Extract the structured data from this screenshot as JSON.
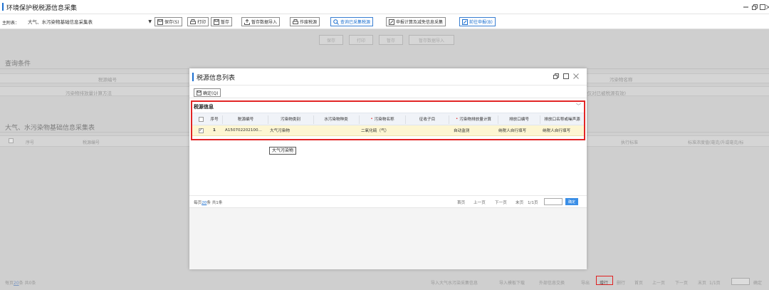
{
  "window": {
    "title": "环境保护税税源信息采集"
  },
  "toolbar": {
    "main_table_label": "主附表：",
    "main_table_value": "大气、水污染物基础信息采集表",
    "buttons": {
      "save": "保存(S)",
      "print": "打印",
      "temp_save": "暂存",
      "import_temp": "暂存数据导入",
      "void_source": "作废税源",
      "query_collected": "查询已采集税源",
      "declare_calc": "申报计算及减免信息采集",
      "to_declare": "前往申报(B)"
    }
  },
  "background": {
    "action_buttons": [
      "保存",
      "打印",
      "暂存",
      "暂存数据导入"
    ],
    "query_section": "查询条件",
    "query_fields": {
      "tax_source_no": "税源编号",
      "pollutant_name": "污染物名称",
      "calc_method": "污染物排放量计算方法",
      "valid_only": "(仅对已被税源有效)"
    },
    "table_section": "大气、水污染物基础信息采集表",
    "columns": {
      "seq": "序号",
      "tax_source_no": "税源编号",
      "exec_standard": "执行标准",
      "concentration": "标准浓度值(毫克/升或毫克/标"
    },
    "footer": {
      "per_page": "每页",
      "per_page_num": "20",
      "per_page_suffix": "条 共0条",
      "import_air_water": "导入大气水污染采集信息",
      "import_template": "导入模板下载",
      "external_exchange": "外部信息交换",
      "export": "导出",
      "add_row": "增行",
      "delete_row": "删行",
      "first": "首页",
      "prev": "上一页",
      "next": "下一页",
      "last": "末页",
      "page": "1/1页",
      "confirm": "确定"
    }
  },
  "modal": {
    "title": "税源信息列表",
    "confirm_button": "确定(Q)",
    "section_title": "税源信息",
    "columns": {
      "seq": "序号",
      "tax_source_no": "税源编号",
      "pollutant_category": "污染物类别",
      "water_pollutant_type": "水污染物种类",
      "pollutant_name": "污染物名称",
      "tax_sub_item": "征收子目",
      "emission_calc": "污染物排放量计算",
      "outlet_no": "排放口编号",
      "outlet_name": "排放口名称或噪声源"
    },
    "rows": [
      {
        "seq": "1",
        "tax_source_no": "A150702202100...",
        "pollutant_category": "大气污染物",
        "water_pollutant_type": "",
        "pollutant_name": "二氧化硫（气）",
        "tax_sub_item": "",
        "emission_calc": "自动监测",
        "outlet_no": "纳税人自行填写",
        "outlet_name": "纳税人自行填写"
      }
    ],
    "tooltip": "大气污染物",
    "pager": {
      "per_page": "每页",
      "per_page_num": "20",
      "per_page_suffix": "条 共1条",
      "first": "首页",
      "prev": "上一页",
      "next": "下一页",
      "last": "末页",
      "page": "1/1页",
      "go": "确定"
    }
  }
}
